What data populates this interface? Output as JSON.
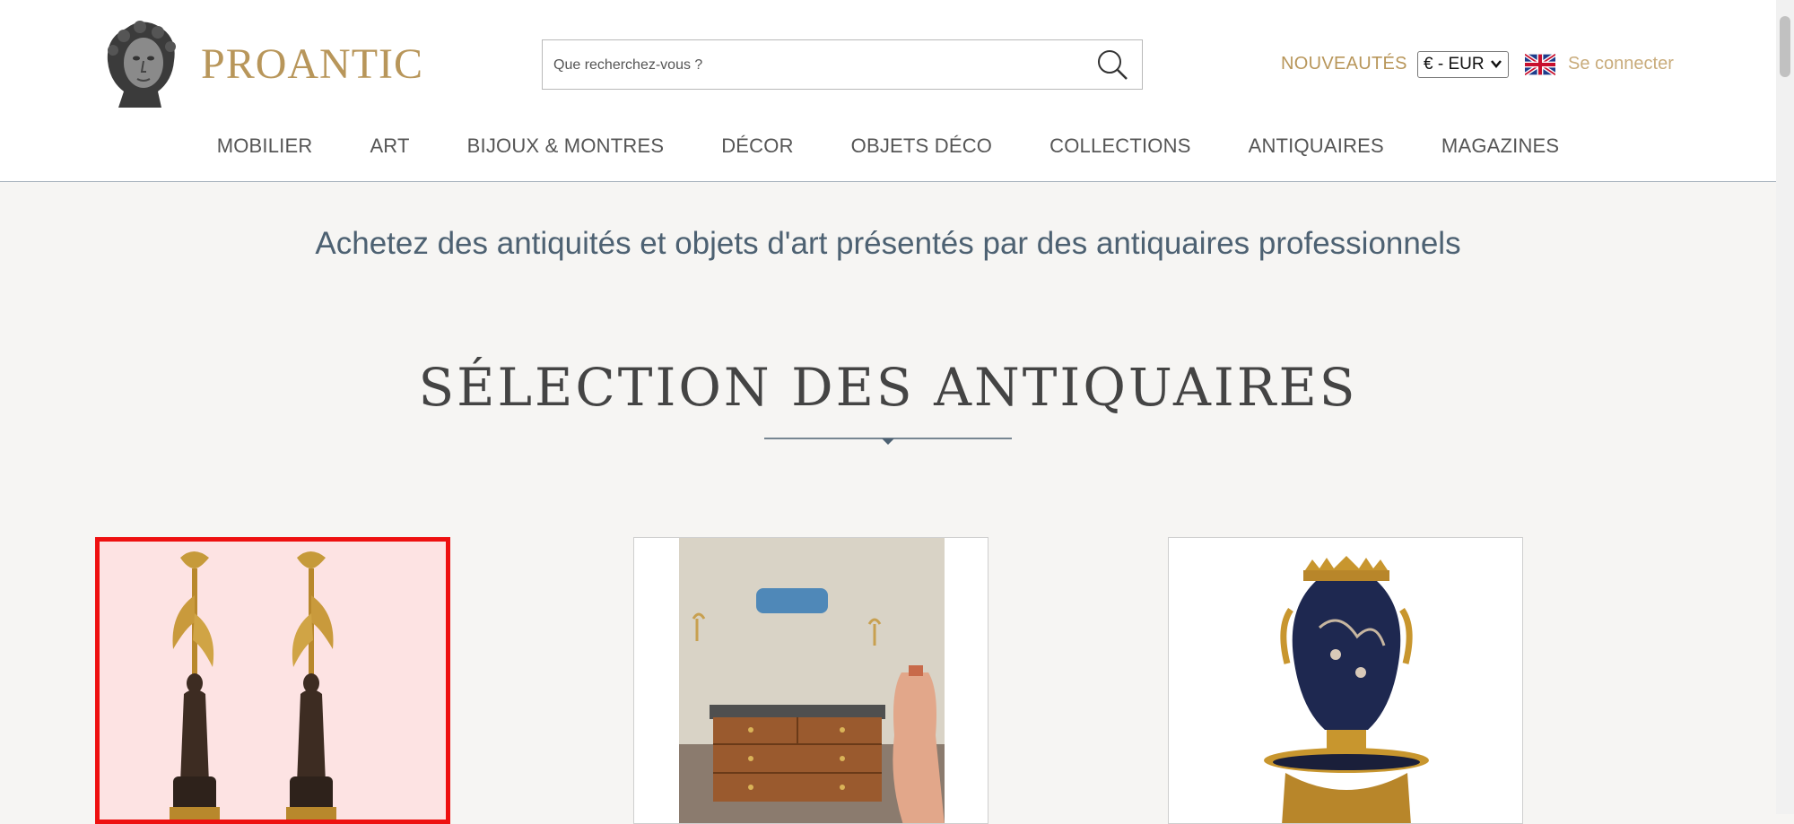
{
  "header": {
    "brand": "PROANTIC",
    "search_placeholder": "Que recherchez-vous ?",
    "nouveautes": "NOUVEAUTÉS",
    "currency": "€ - EUR",
    "login": "Se connecter"
  },
  "nav": [
    "MOBILIER",
    "ART",
    "BIJOUX & MONTRES",
    "DÉCOR",
    "OBJETS DÉCO",
    "COLLECTIONS",
    "ANTIQUAIRES",
    "MAGAZINES"
  ],
  "tagline": "Achetez des antiquités et objets d'art présentés par des antiquaires professionnels",
  "section_title": "SÉLECTION DES ANTIQUAIRES",
  "colors": {
    "brand_gold": "#b8965a",
    "nav_text": "#555555",
    "tagline_blue": "#4d6172",
    "selection_red": "#ee1010"
  },
  "icons": {
    "search": "magnifier-icon",
    "flag": "uk-flag-icon",
    "logo": "bust-logo"
  }
}
